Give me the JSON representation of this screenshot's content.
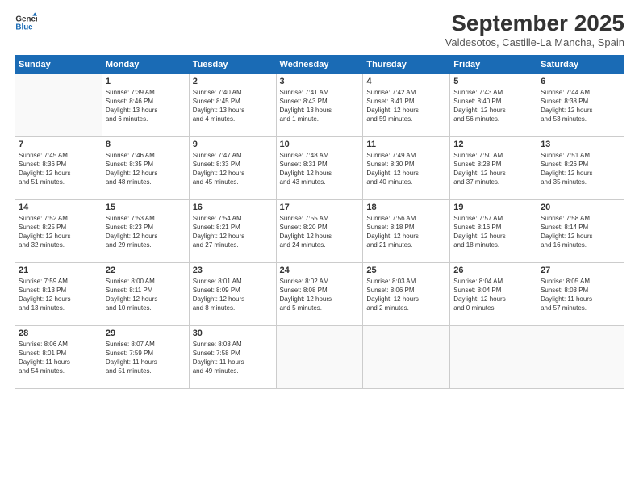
{
  "logo": {
    "line1": "General",
    "line2": "Blue"
  },
  "title": "September 2025",
  "location": "Valdesotos, Castille-La Mancha, Spain",
  "weekdays": [
    "Sunday",
    "Monday",
    "Tuesday",
    "Wednesday",
    "Thursday",
    "Friday",
    "Saturday"
  ],
  "weeks": [
    [
      {
        "day": "",
        "info": ""
      },
      {
        "day": "1",
        "info": "Sunrise: 7:39 AM\nSunset: 8:46 PM\nDaylight: 13 hours\nand 6 minutes."
      },
      {
        "day": "2",
        "info": "Sunrise: 7:40 AM\nSunset: 8:45 PM\nDaylight: 13 hours\nand 4 minutes."
      },
      {
        "day": "3",
        "info": "Sunrise: 7:41 AM\nSunset: 8:43 PM\nDaylight: 13 hours\nand 1 minute."
      },
      {
        "day": "4",
        "info": "Sunrise: 7:42 AM\nSunset: 8:41 PM\nDaylight: 12 hours\nand 59 minutes."
      },
      {
        "day": "5",
        "info": "Sunrise: 7:43 AM\nSunset: 8:40 PM\nDaylight: 12 hours\nand 56 minutes."
      },
      {
        "day": "6",
        "info": "Sunrise: 7:44 AM\nSunset: 8:38 PM\nDaylight: 12 hours\nand 53 minutes."
      }
    ],
    [
      {
        "day": "7",
        "info": "Sunrise: 7:45 AM\nSunset: 8:36 PM\nDaylight: 12 hours\nand 51 minutes."
      },
      {
        "day": "8",
        "info": "Sunrise: 7:46 AM\nSunset: 8:35 PM\nDaylight: 12 hours\nand 48 minutes."
      },
      {
        "day": "9",
        "info": "Sunrise: 7:47 AM\nSunset: 8:33 PM\nDaylight: 12 hours\nand 45 minutes."
      },
      {
        "day": "10",
        "info": "Sunrise: 7:48 AM\nSunset: 8:31 PM\nDaylight: 12 hours\nand 43 minutes."
      },
      {
        "day": "11",
        "info": "Sunrise: 7:49 AM\nSunset: 8:30 PM\nDaylight: 12 hours\nand 40 minutes."
      },
      {
        "day": "12",
        "info": "Sunrise: 7:50 AM\nSunset: 8:28 PM\nDaylight: 12 hours\nand 37 minutes."
      },
      {
        "day": "13",
        "info": "Sunrise: 7:51 AM\nSunset: 8:26 PM\nDaylight: 12 hours\nand 35 minutes."
      }
    ],
    [
      {
        "day": "14",
        "info": "Sunrise: 7:52 AM\nSunset: 8:25 PM\nDaylight: 12 hours\nand 32 minutes."
      },
      {
        "day": "15",
        "info": "Sunrise: 7:53 AM\nSunset: 8:23 PM\nDaylight: 12 hours\nand 29 minutes."
      },
      {
        "day": "16",
        "info": "Sunrise: 7:54 AM\nSunset: 8:21 PM\nDaylight: 12 hours\nand 27 minutes."
      },
      {
        "day": "17",
        "info": "Sunrise: 7:55 AM\nSunset: 8:20 PM\nDaylight: 12 hours\nand 24 minutes."
      },
      {
        "day": "18",
        "info": "Sunrise: 7:56 AM\nSunset: 8:18 PM\nDaylight: 12 hours\nand 21 minutes."
      },
      {
        "day": "19",
        "info": "Sunrise: 7:57 AM\nSunset: 8:16 PM\nDaylight: 12 hours\nand 18 minutes."
      },
      {
        "day": "20",
        "info": "Sunrise: 7:58 AM\nSunset: 8:14 PM\nDaylight: 12 hours\nand 16 minutes."
      }
    ],
    [
      {
        "day": "21",
        "info": "Sunrise: 7:59 AM\nSunset: 8:13 PM\nDaylight: 12 hours\nand 13 minutes."
      },
      {
        "day": "22",
        "info": "Sunrise: 8:00 AM\nSunset: 8:11 PM\nDaylight: 12 hours\nand 10 minutes."
      },
      {
        "day": "23",
        "info": "Sunrise: 8:01 AM\nSunset: 8:09 PM\nDaylight: 12 hours\nand 8 minutes."
      },
      {
        "day": "24",
        "info": "Sunrise: 8:02 AM\nSunset: 8:08 PM\nDaylight: 12 hours\nand 5 minutes."
      },
      {
        "day": "25",
        "info": "Sunrise: 8:03 AM\nSunset: 8:06 PM\nDaylight: 12 hours\nand 2 minutes."
      },
      {
        "day": "26",
        "info": "Sunrise: 8:04 AM\nSunset: 8:04 PM\nDaylight: 12 hours\nand 0 minutes."
      },
      {
        "day": "27",
        "info": "Sunrise: 8:05 AM\nSunset: 8:03 PM\nDaylight: 11 hours\nand 57 minutes."
      }
    ],
    [
      {
        "day": "28",
        "info": "Sunrise: 8:06 AM\nSunset: 8:01 PM\nDaylight: 11 hours\nand 54 minutes."
      },
      {
        "day": "29",
        "info": "Sunrise: 8:07 AM\nSunset: 7:59 PM\nDaylight: 11 hours\nand 51 minutes."
      },
      {
        "day": "30",
        "info": "Sunrise: 8:08 AM\nSunset: 7:58 PM\nDaylight: 11 hours\nand 49 minutes."
      },
      {
        "day": "",
        "info": ""
      },
      {
        "day": "",
        "info": ""
      },
      {
        "day": "",
        "info": ""
      },
      {
        "day": "",
        "info": ""
      }
    ]
  ]
}
